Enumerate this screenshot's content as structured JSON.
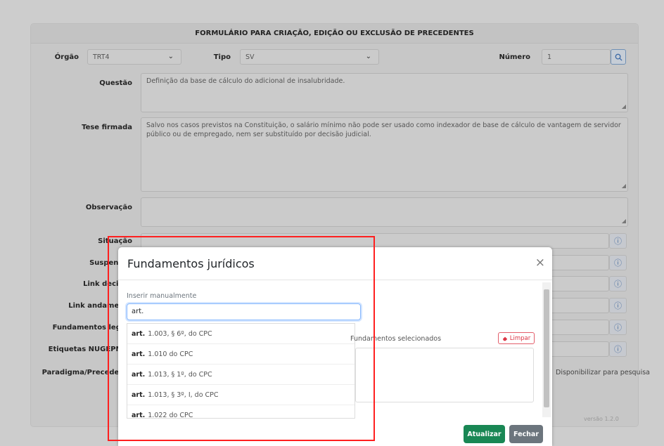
{
  "form": {
    "title": "FORMULÁRIO PARA CRIAÇÃO, EDIÇÃO OU EXCLUSÃO DE PRECEDENTES",
    "orgao_label": "Órgão",
    "orgao_value": "TRT4",
    "tipo_label": "Tipo",
    "tipo_value": "SV",
    "numero_label": "Número",
    "numero_value": "1",
    "questao_label": "Questão",
    "questao_value": "Definição da base de cálculo do adicional de insalubridade.",
    "tese_label": "Tese firmada",
    "tese_value": "Salvo nos casos previstos na Constituição, o salário mínimo não pode ser usado como indexador de base de cálculo de vantagem de servidor público ou de empregado, nem ser substituído por decisão judicial.",
    "observacao_label": "Observação",
    "situacao_label": "Situação",
    "suspensao_label": "Suspensão",
    "link_decisao_label": "Link decisão",
    "link_andamento_label": "Link andamento",
    "fundamentos_label": "Fundamentos legais",
    "etiquetas_label": "Etiquetas NUGEPNAC",
    "paradigma_label": "Paradigma/Precedente",
    "disponibilizar_text": "Disponibilizar para pesquisa",
    "version_text": "versão 1.2.0"
  },
  "modal": {
    "title": "Fundamentos jurídicos",
    "close_symbol": "×",
    "manual_label": "Inserir manualmente",
    "input_value": "art.",
    "suggestions": [
      {
        "bold": "art.",
        "rest": "1.003, § 6º, do CPC"
      },
      {
        "bold": "art.",
        "rest": "1.010 do CPC"
      },
      {
        "bold": "art.",
        "rest": "1.013, § 1º, do CPC"
      },
      {
        "bold": "art.",
        "rest": "1.013, § 3º, I, do CPC"
      },
      {
        "bold": "art.",
        "rest": "1.022 do CPC"
      }
    ],
    "selected_label": "Fundamentos selecionados",
    "clear_label": "Limpar",
    "clear_icon": "eraser-icon",
    "update_label": "Atualizar",
    "close_label": "Fechar"
  },
  "colors": {
    "highlight": "#ff1f1f",
    "update_button": "#198754",
    "close_button": "#6c757d"
  }
}
